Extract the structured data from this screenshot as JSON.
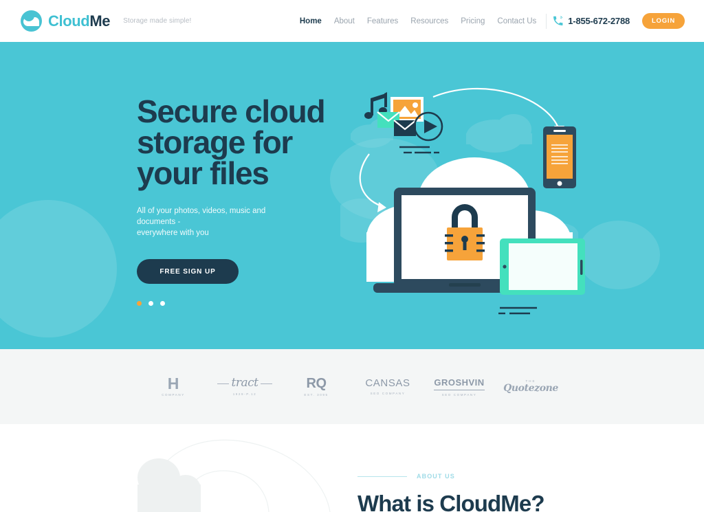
{
  "header": {
    "brand": {
      "part1": "Cloud",
      "part2": "Me",
      "icon": "cloud-logo-icon",
      "tagline": "Storage made simple!"
    },
    "nav": [
      {
        "label": "Home",
        "active": true
      },
      {
        "label": "About",
        "active": false
      },
      {
        "label": "Features",
        "active": false
      },
      {
        "label": "Resources",
        "active": false
      },
      {
        "label": "Pricing",
        "active": false
      },
      {
        "label": "Contact Us",
        "active": false
      }
    ],
    "phone": {
      "icon": "phone-icon",
      "number": "1-855-672-2788"
    },
    "login_label": "LOGIN"
  },
  "hero": {
    "title_line1": "Secure cloud",
    "title_line2": "storage for",
    "title_line3": "your files",
    "subtitle_line1": "All of your photos, videos, music and documents -",
    "subtitle_line2": "everywhere with you",
    "cta_label": "FREE SIGN UP",
    "carousel": {
      "total": 3,
      "active_index": 0
    },
    "illustration": {
      "name": "cloud-devices-illustration",
      "items": [
        "music-note-icon",
        "photo-icon",
        "envelope-teal-icon",
        "envelope-dark-icon",
        "play-button-icon",
        "laptop-icon",
        "padlock-icon",
        "smartphone-icon",
        "tablet-icon",
        "cloud-shape",
        "arrow-curve"
      ]
    },
    "colors": {
      "background": "#4ac6d5",
      "accent": "#f6a33a",
      "dark": "#1d3b4e"
    }
  },
  "logos": [
    {
      "mark": "H",
      "sub": "COMPANY",
      "style": "letter"
    },
    {
      "mark": "tract",
      "sub": "1929-P.12",
      "style": "script"
    },
    {
      "mark": "RQ",
      "sub": "EST. 3095",
      "style": "letter"
    },
    {
      "mark": "CANSAS",
      "sub": "SEO COMPANY",
      "style": "plain"
    },
    {
      "mark": "GROSHVIN",
      "sub": "SEO COMPANY",
      "style": "ruled"
    },
    {
      "mark": "Quotezone",
      "sub": "THE",
      "style": "quote"
    }
  ],
  "about": {
    "eyebrow": "ABOUT US",
    "title": "What is CloudMe?"
  }
}
